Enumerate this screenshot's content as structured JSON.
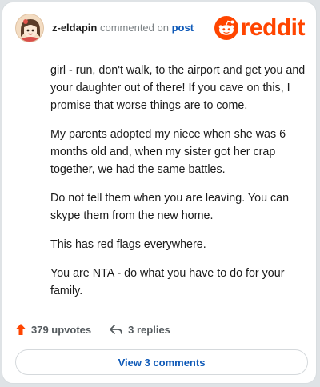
{
  "comment": {
    "username": "z-eldapin",
    "verb": "commented on",
    "target": "post",
    "brand": "reddit",
    "paragraphs": [
      "girl - run, don't walk, to the airport and get you and your daughter out of there! If you cave on this, I promise that worse things are to come.",
      "My parents adopted my niece when she was 6 months old and, when my sister got her crap together, we had the same battles.",
      "Do not tell them when you are leaving. You can skype them from the new home.",
      "This has red flags everywhere.",
      "You are NTA - do what you have to do for your family."
    ],
    "upvotes": "379 upvotes",
    "replies": "3 replies",
    "view_comments": "View 3 comments"
  },
  "colors": {
    "brand": "#ff4500",
    "link": "#0f5ab8",
    "upvote": "#ff4500"
  },
  "icons": {
    "avatar": "avatar",
    "logo": "reddit-snoo-icon",
    "upvote": "upvote-arrow-icon",
    "reply": "reply-arrow-icon"
  }
}
